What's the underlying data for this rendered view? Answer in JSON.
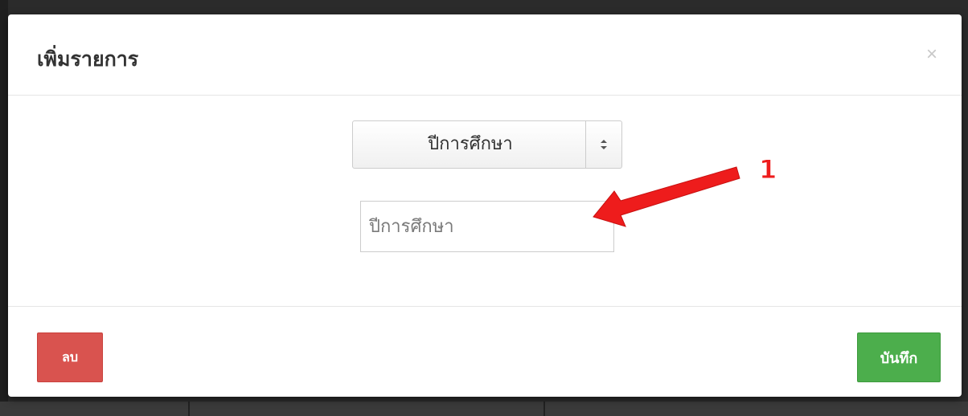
{
  "modal": {
    "title": "เพิ่มรายการ",
    "close_label": "×"
  },
  "form": {
    "select": {
      "selected_value": "ปีการศึกษา",
      "arrow_icon": "updown-arrows-icon",
      "arrow_glyph": "⬍"
    },
    "input": {
      "value": "",
      "placeholder": "ปีการศึกษา"
    }
  },
  "footer": {
    "delete_label": "ลบ",
    "save_label": "บันทึก"
  },
  "annotation": {
    "number": "1",
    "color": "#ee1c1c"
  },
  "colors": {
    "delete_button": "#d9534f",
    "save_button": "#4cae4c"
  }
}
